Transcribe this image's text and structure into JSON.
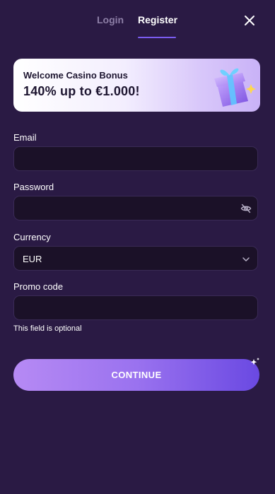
{
  "tabs": {
    "login_label": "Login",
    "register_label": "Register",
    "active": "Register"
  },
  "banner": {
    "subtitle": "Welcome Casino Bonus",
    "title": "140% up to €1.000!"
  },
  "form": {
    "email": {
      "label": "Email",
      "value": "",
      "placeholder": ""
    },
    "password": {
      "label": "Password",
      "value": "",
      "placeholder": ""
    },
    "currency": {
      "label": "Currency",
      "value": "EUR"
    },
    "promo": {
      "label": "Promo code",
      "value": "",
      "placeholder": "",
      "hint": "This field is optional"
    }
  },
  "continue_label": "CONTINUE",
  "icons": {
    "close": "close-icon",
    "eye": "eye-slash-icon",
    "chevron": "chevron-down-icon",
    "gift": "gift-icon",
    "sparkle": "sparkle-icon"
  },
  "colors": {
    "background": "#2a1a44",
    "field_bg": "#1b1128",
    "accent": "#7b5cf0",
    "muted_tab": "#8d7fa6"
  }
}
